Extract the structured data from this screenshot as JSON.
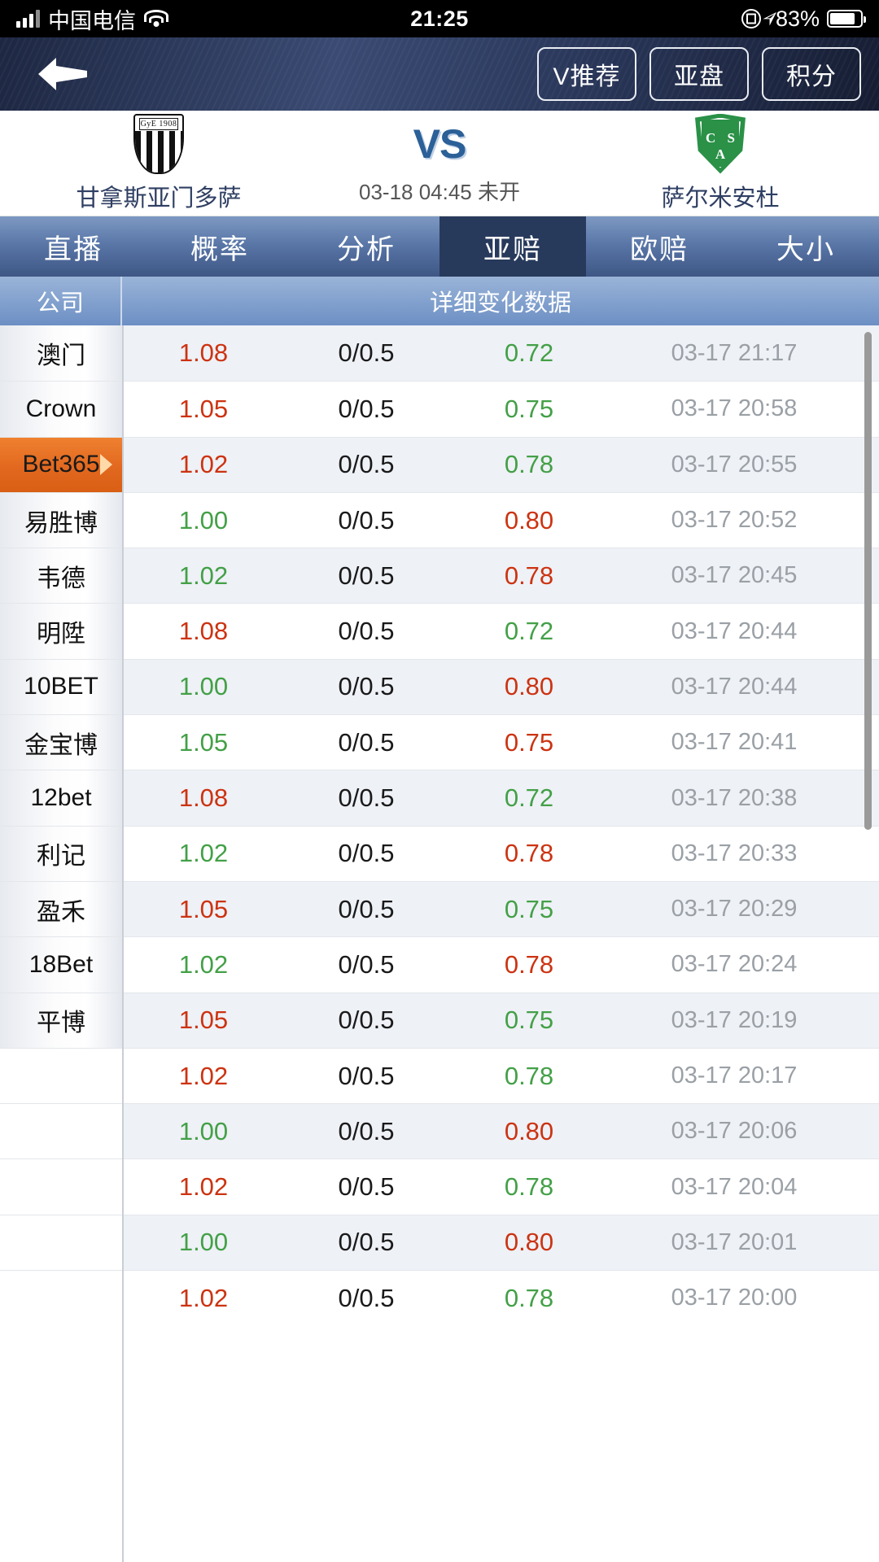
{
  "status_bar": {
    "carrier": "中国电信",
    "time": "21:25",
    "battery_percent": "83%",
    "icons": [
      "signal-bars-icon",
      "wifi-icon",
      "rotation-lock-icon",
      "location-arrow-icon",
      "battery-icon"
    ]
  },
  "nav": {
    "back_icon": "back-arrow-icon",
    "buttons": [
      {
        "label": "V推荐"
      },
      {
        "label": "亚盘"
      },
      {
        "label": "积分"
      }
    ]
  },
  "match": {
    "home_team": "甘拿斯亚门多萨",
    "home_crest_text": "GyE 1908",
    "away_team": "萨尔米安杜",
    "away_crest_letters": [
      "C",
      "S",
      "A"
    ],
    "vs_label": "VS",
    "datetime": "03-18 04:45 未开"
  },
  "tabs": [
    {
      "label": "直播",
      "active": false
    },
    {
      "label": "概率",
      "active": false
    },
    {
      "label": "分析",
      "active": false
    },
    {
      "label": "亚赔",
      "active": true
    },
    {
      "label": "欧赔",
      "active": false
    },
    {
      "label": "大小",
      "active": false
    }
  ],
  "table": {
    "header_company": "公司",
    "header_detail": "详细变化数据",
    "selected_company": "Bet365",
    "rows": [
      {
        "company": "澳门",
        "home_odds": "1.08",
        "home_dir": "up",
        "handicap": "0/0.5",
        "away_odds": "0.72",
        "away_dir": "down",
        "time": "03-17 21:17"
      },
      {
        "company": "Crown",
        "home_odds": "1.05",
        "home_dir": "up",
        "handicap": "0/0.5",
        "away_odds": "0.75",
        "away_dir": "down",
        "time": "03-17 20:58"
      },
      {
        "company": "Bet365",
        "home_odds": "1.02",
        "home_dir": "up",
        "handicap": "0/0.5",
        "away_odds": "0.78",
        "away_dir": "down",
        "time": "03-17 20:55"
      },
      {
        "company": "易胜博",
        "home_odds": "1.00",
        "home_dir": "down",
        "handicap": "0/0.5",
        "away_odds": "0.80",
        "away_dir": "up",
        "time": "03-17 20:52"
      },
      {
        "company": "韦德",
        "home_odds": "1.02",
        "home_dir": "down",
        "handicap": "0/0.5",
        "away_odds": "0.78",
        "away_dir": "up",
        "time": "03-17 20:45"
      },
      {
        "company": "明陞",
        "home_odds": "1.08",
        "home_dir": "up",
        "handicap": "0/0.5",
        "away_odds": "0.72",
        "away_dir": "down",
        "time": "03-17 20:44"
      },
      {
        "company": "10BET",
        "home_odds": "1.00",
        "home_dir": "down",
        "handicap": "0/0.5",
        "away_odds": "0.80",
        "away_dir": "up",
        "time": "03-17 20:44"
      },
      {
        "company": "金宝博",
        "home_odds": "1.05",
        "home_dir": "down",
        "handicap": "0/0.5",
        "away_odds": "0.75",
        "away_dir": "up",
        "time": "03-17 20:41"
      },
      {
        "company": "12bet",
        "home_odds": "1.08",
        "home_dir": "up",
        "handicap": "0/0.5",
        "away_odds": "0.72",
        "away_dir": "down",
        "time": "03-17 20:38"
      },
      {
        "company": "利记",
        "home_odds": "1.02",
        "home_dir": "down",
        "handicap": "0/0.5",
        "away_odds": "0.78",
        "away_dir": "up",
        "time": "03-17 20:33"
      },
      {
        "company": "盈禾",
        "home_odds": "1.05",
        "home_dir": "up",
        "handicap": "0/0.5",
        "away_odds": "0.75",
        "away_dir": "down",
        "time": "03-17 20:29"
      },
      {
        "company": "18Bet",
        "home_odds": "1.02",
        "home_dir": "down",
        "handicap": "0/0.5",
        "away_odds": "0.78",
        "away_dir": "up",
        "time": "03-17 20:24"
      },
      {
        "company": "平博",
        "home_odds": "1.05",
        "home_dir": "up",
        "handicap": "0/0.5",
        "away_odds": "0.75",
        "away_dir": "down",
        "time": "03-17 20:19"
      },
      {
        "company": "",
        "home_odds": "1.02",
        "home_dir": "up",
        "handicap": "0/0.5",
        "away_odds": "0.78",
        "away_dir": "down",
        "time": "03-17 20:17"
      },
      {
        "company": "",
        "home_odds": "1.00",
        "home_dir": "down",
        "handicap": "0/0.5",
        "away_odds": "0.80",
        "away_dir": "up",
        "time": "03-17 20:06"
      },
      {
        "company": "",
        "home_odds": "1.02",
        "home_dir": "up",
        "handicap": "0/0.5",
        "away_odds": "0.78",
        "away_dir": "down",
        "time": "03-17 20:04"
      },
      {
        "company": "",
        "home_odds": "1.00",
        "home_dir": "down",
        "handicap": "0/0.5",
        "away_odds": "0.80",
        "away_dir": "up",
        "time": "03-17 20:01"
      },
      {
        "company": "",
        "home_odds": "1.02",
        "home_dir": "up",
        "handicap": "0/0.5",
        "away_odds": "0.78",
        "away_dir": "down",
        "time": "03-17 20:00"
      }
    ]
  },
  "colors": {
    "up": "#cc3311",
    "down": "#43a047",
    "selected_row": "#e2681f",
    "nav_bg": "#2c3a5e",
    "tab_active": "#283a5c"
  }
}
